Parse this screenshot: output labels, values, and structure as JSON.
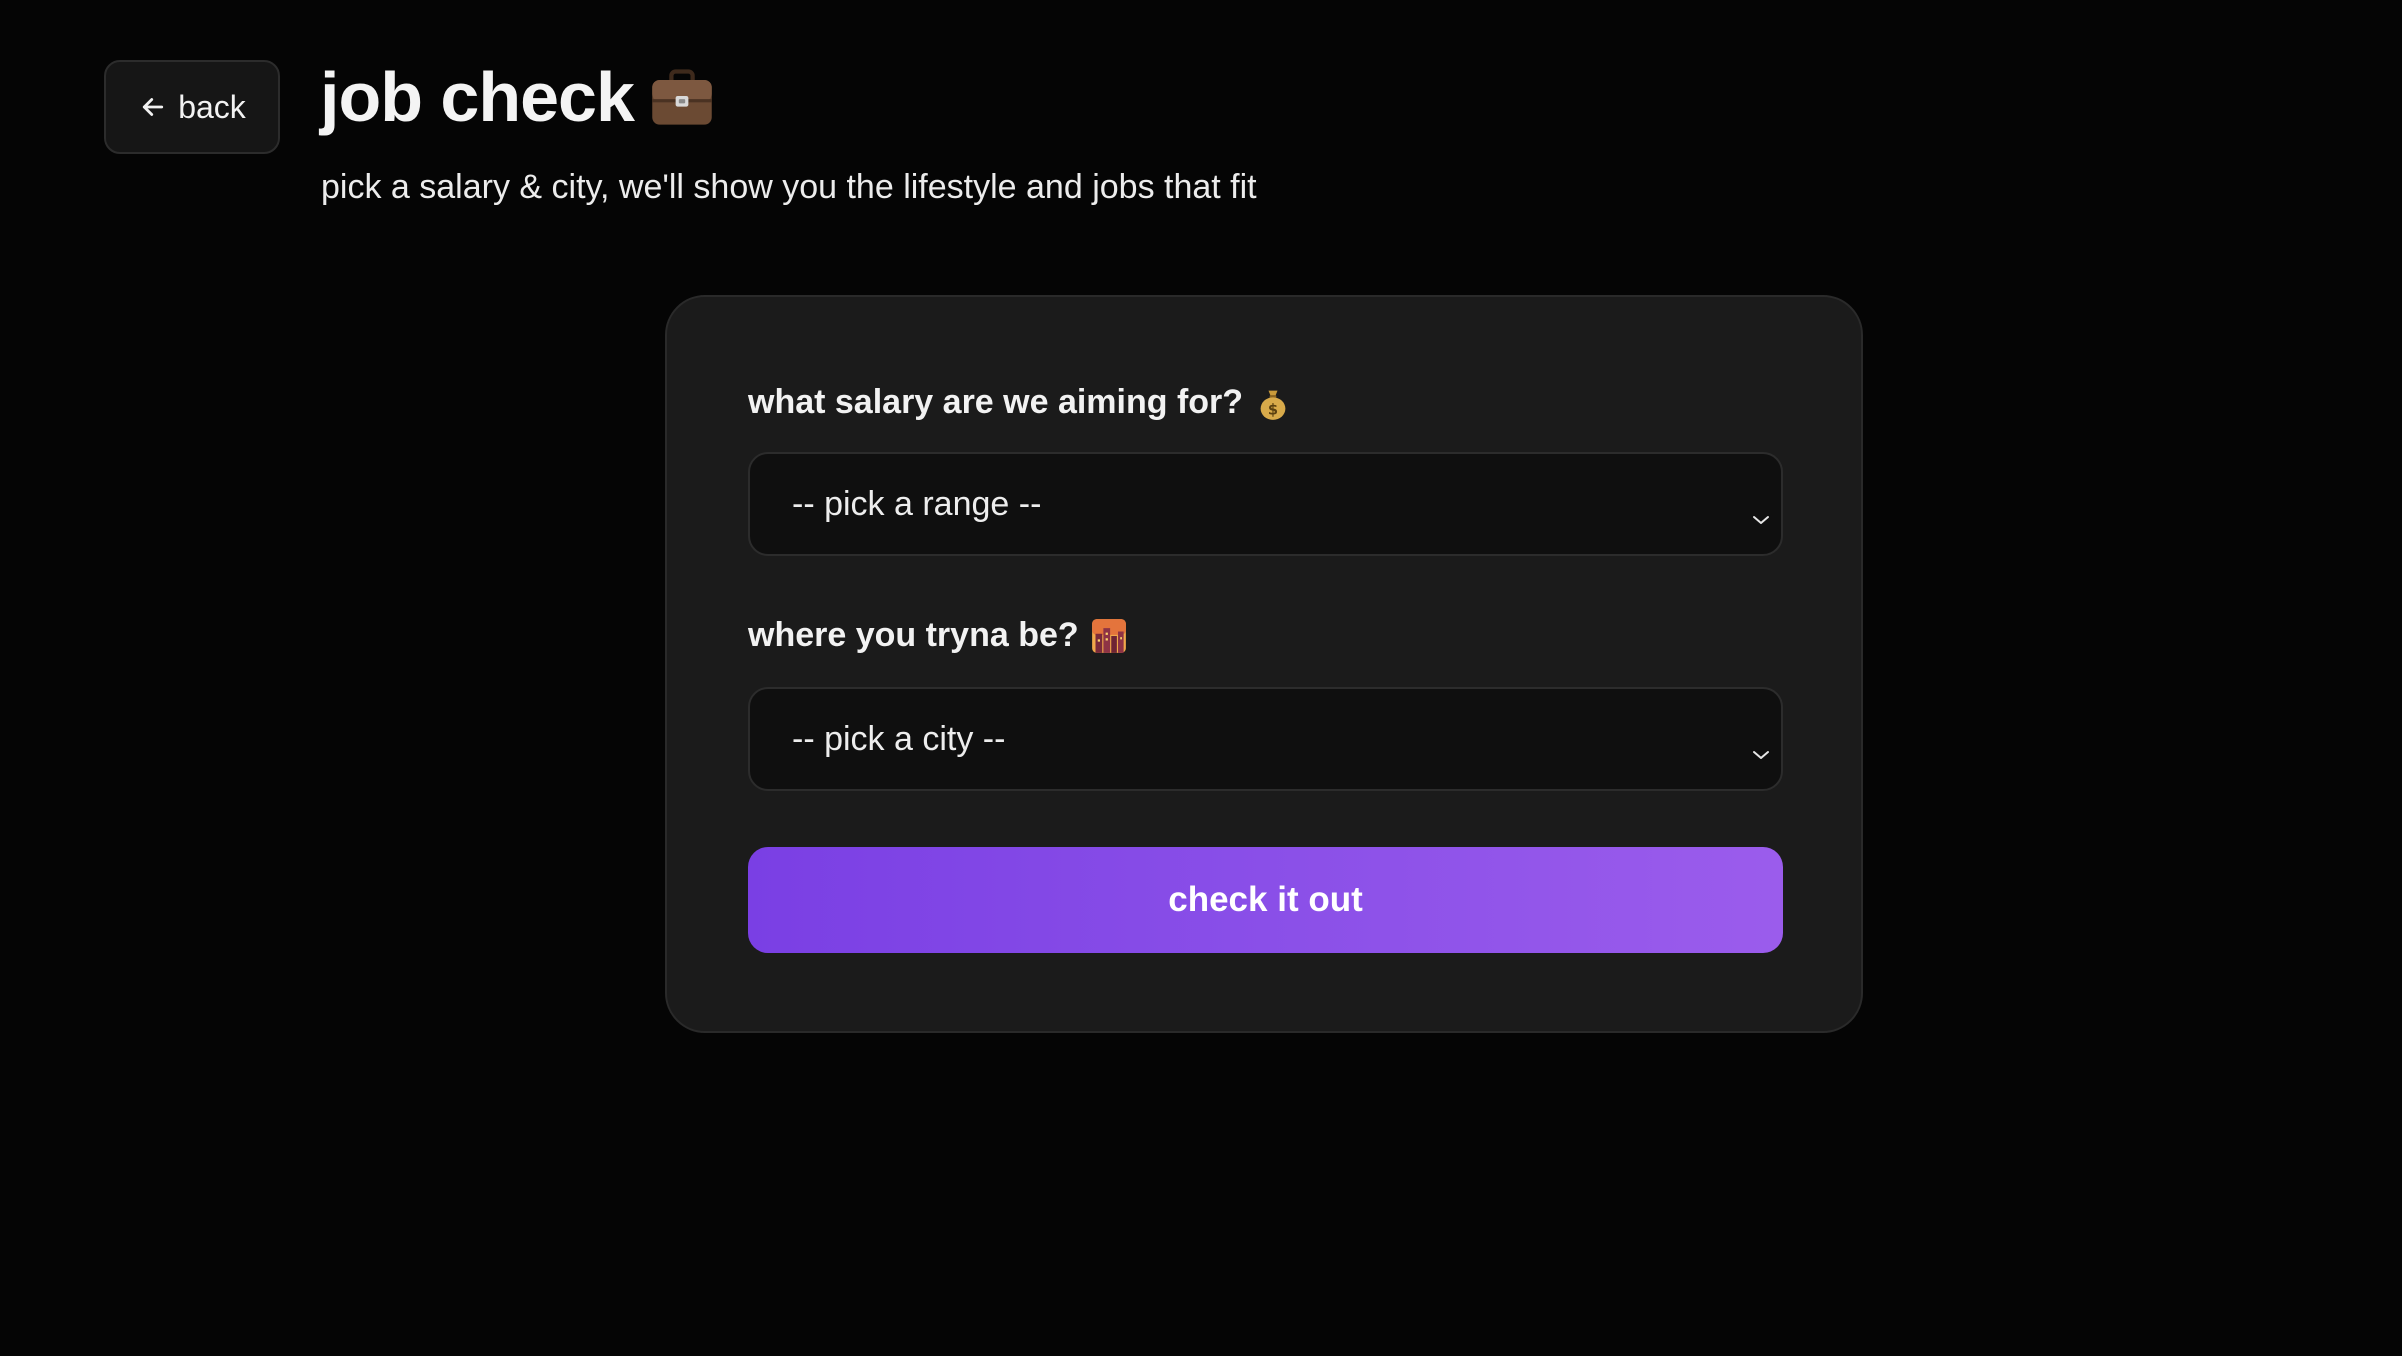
{
  "header": {
    "back_label": "back",
    "title": "job check",
    "title_icon": "briefcase-icon",
    "subtitle": "pick a salary & city, we'll show you the lifestyle and jobs that fit"
  },
  "form": {
    "salary": {
      "label": "what salary are we aiming for?",
      "label_icon": "money-bag-icon",
      "selected": "-- pick a range --"
    },
    "city": {
      "label": "where you tryna be?",
      "label_icon": "city-sunset-icon",
      "selected": "-- pick a city --"
    },
    "submit_label": "check it out"
  },
  "colors": {
    "background": "#050505",
    "card": "#1b1b1b",
    "accent_start": "#7a3fe4",
    "accent_end": "#9b5cec"
  }
}
